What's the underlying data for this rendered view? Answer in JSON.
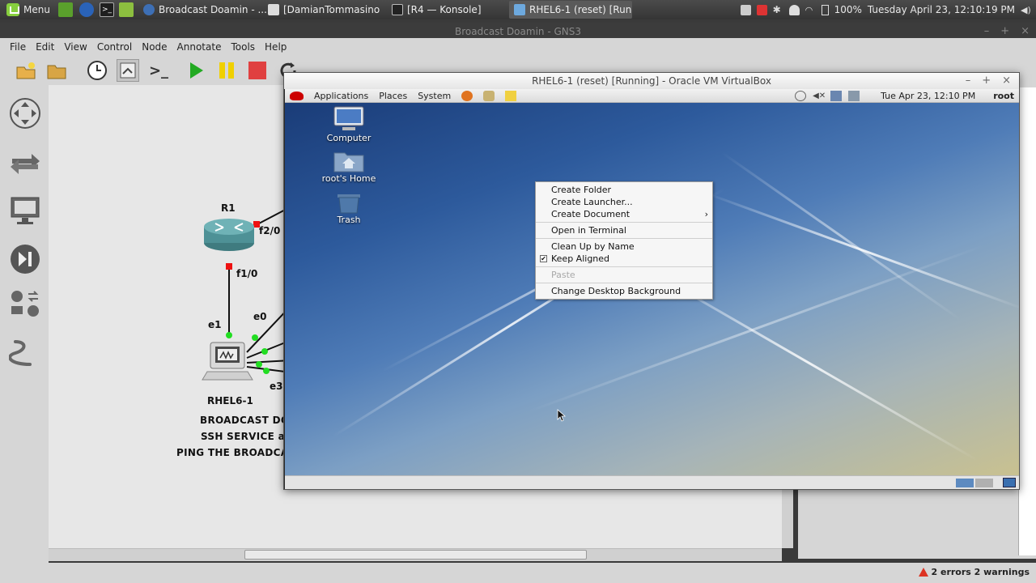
{
  "system_panel": {
    "menu_label": "Menu",
    "tasks": [
      {
        "label": "Broadcast Doamin - ..."
      },
      {
        "label": "[DamianTommasino..."
      },
      {
        "label": "[R4 — Konsole]"
      },
      {
        "label": "RHEL6-1 (reset) [Run..."
      }
    ],
    "battery": "100%",
    "clock": "Tuesday April 23, 12:10:19 PM"
  },
  "gns3": {
    "title": "Broadcast Doamin - GNS3",
    "menus": [
      "File",
      "Edit",
      "View",
      "Control",
      "Node",
      "Annotate",
      "Tools",
      "Help"
    ],
    "topology": {
      "router_label": "R1",
      "router_ports": {
        "f2_0": "f2/0",
        "f1_0": "f1/0"
      },
      "host_label": "RHEL6-1",
      "host_ports": {
        "e1": "e1",
        "e0": "e0",
        "e3": "e3"
      },
      "notes": [
        "BROADCAST DO",
        "SSH SERVICE a",
        "PING THE BROADCA"
      ]
    },
    "status": "2 errors 2 warnings"
  },
  "vbox": {
    "title": "RHEL6-1 (reset) [Running] - Oracle VM VirtualBox",
    "panel_menus": [
      "Applications",
      "Places",
      "System"
    ],
    "panel_clock": "Tue Apr 23, 12:10 PM",
    "panel_user": "root",
    "desktop_icons": [
      {
        "label": "Computer",
        "icon": "computer-icon"
      },
      {
        "label": "root's Home",
        "icon": "home-folder-icon"
      },
      {
        "label": "Trash",
        "icon": "trash-icon"
      }
    ],
    "context_menu": {
      "create_folder": "Create Folder",
      "create_launcher": "Create Launcher...",
      "create_document": "Create Document",
      "open_terminal": "Open in Terminal",
      "clean_up": "Clean Up by Name",
      "keep_aligned": "Keep Aligned",
      "keep_aligned_checked": true,
      "paste": "Paste",
      "change_background": "Change Desktop Background"
    }
  },
  "colors": {
    "link_up": "#22dd22",
    "link_down": "#ee1111",
    "play_green": "#22aa22",
    "pause_yellow": "#f0d000",
    "stop_red": "#e04040"
  }
}
